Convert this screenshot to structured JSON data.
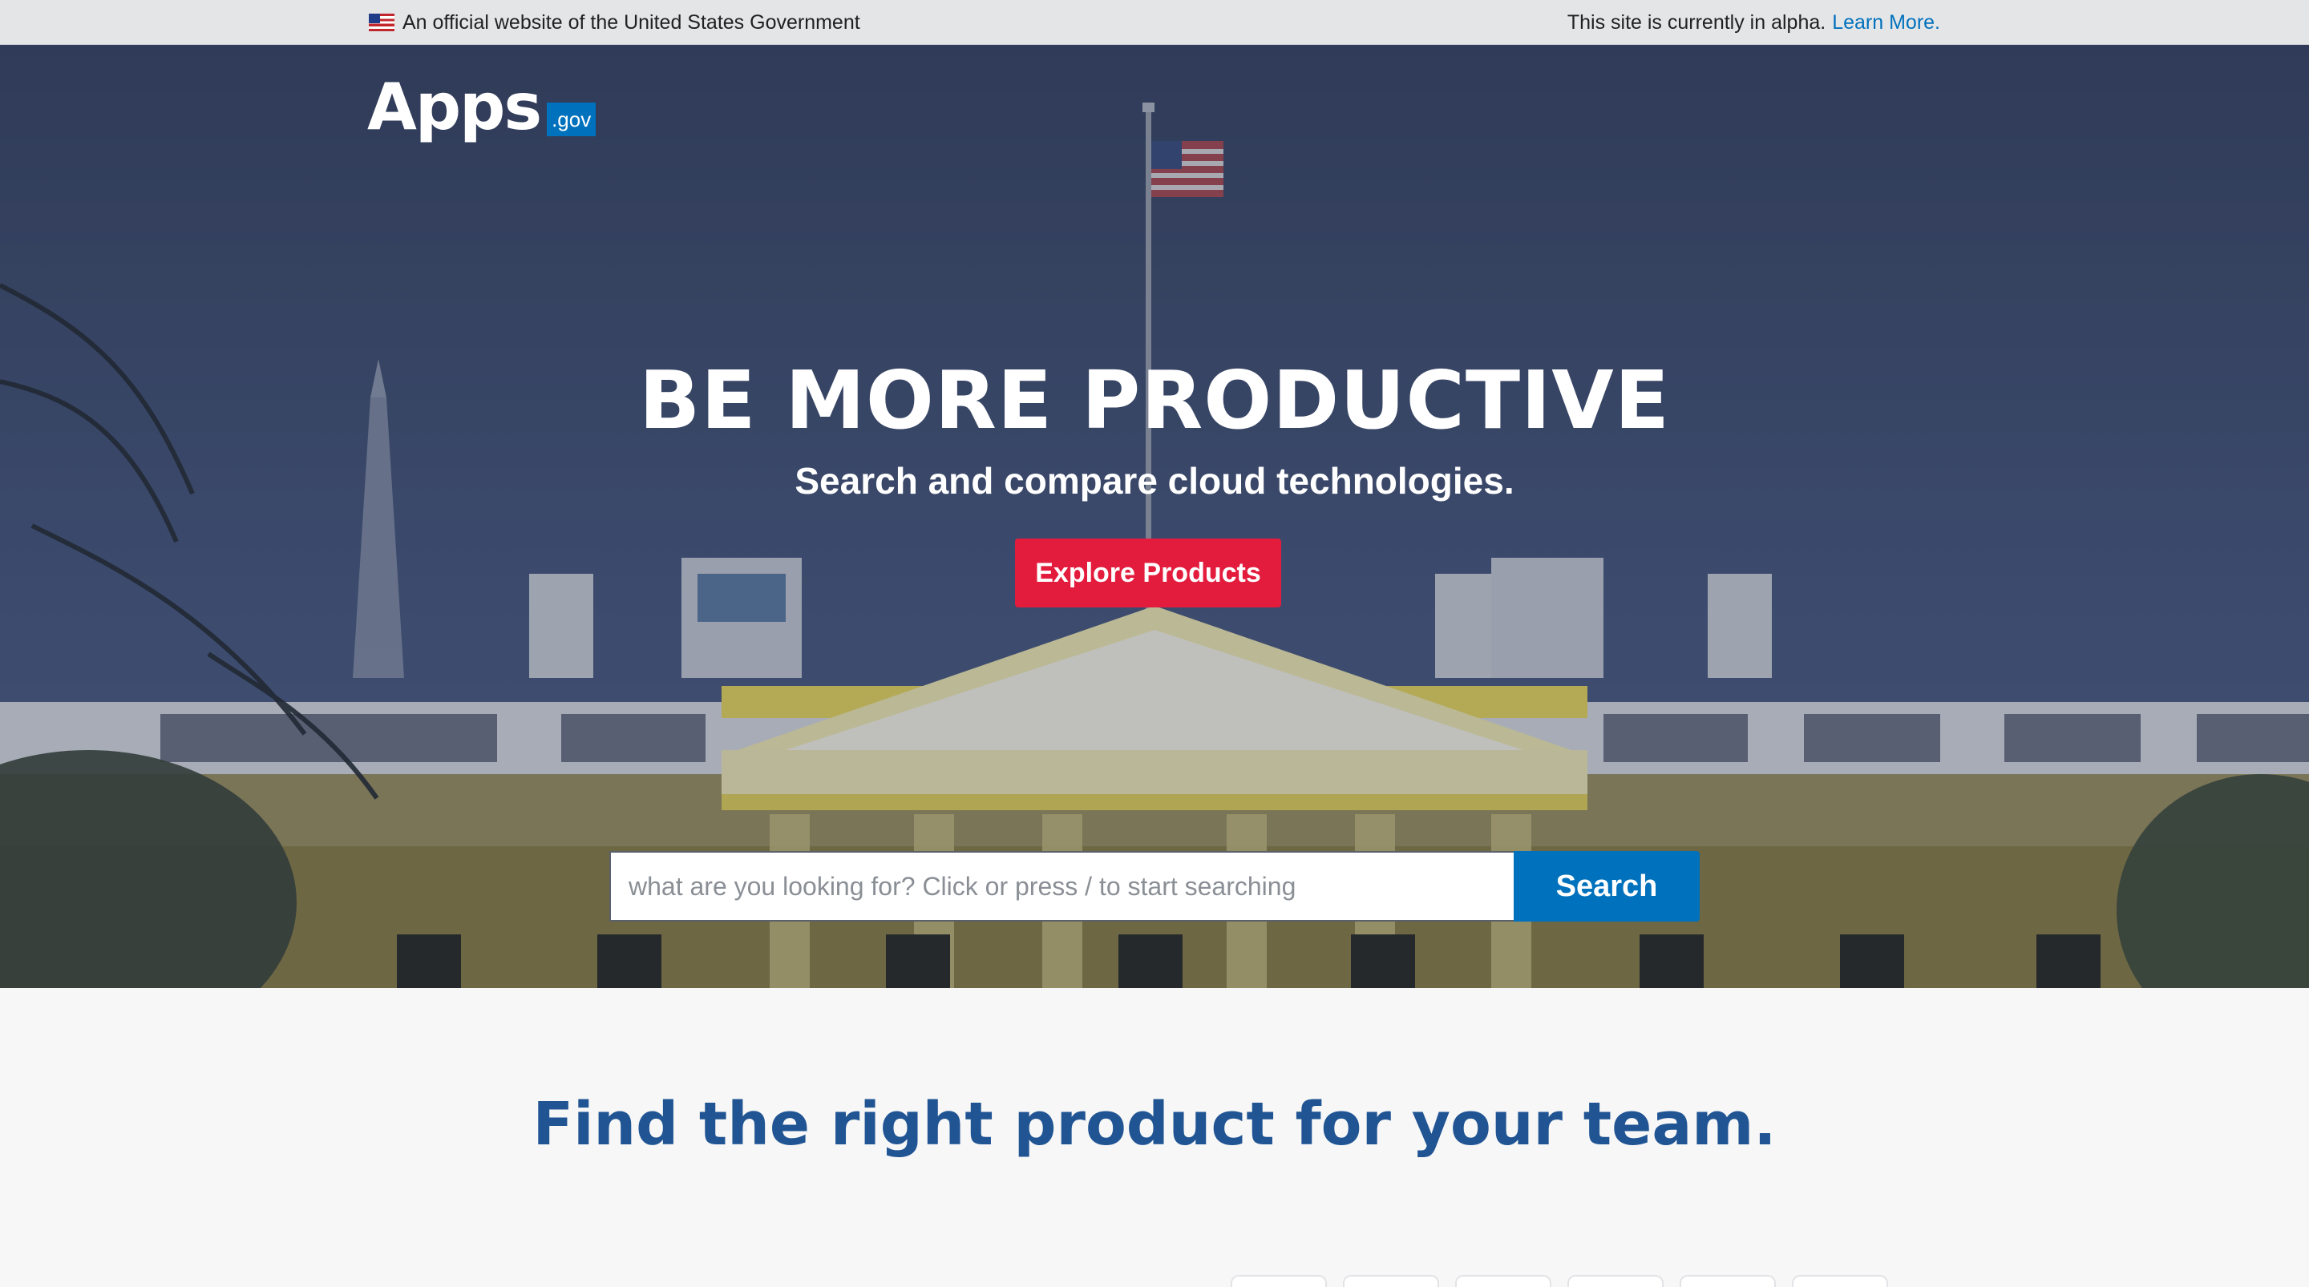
{
  "gov_banner": {
    "official_text": "An official website of the United States Government",
    "alpha_text": "This site is currently in alpha.",
    "learn_more": "Learn More."
  },
  "logo": {
    "word": "Apps",
    "badge": ".gov"
  },
  "hero": {
    "headline": "BE MORE PRODUCTIVE",
    "subheadline": "Search and compare cloud technologies.",
    "explore_button": "Explore Products"
  },
  "search": {
    "placeholder": "what are you looking for? Click or press / to start searching",
    "value": "",
    "button": "Search"
  },
  "section": {
    "title": "Find the right product for your team."
  },
  "icons": {
    "flag": "us-flag-icon"
  },
  "colors": {
    "primary_blue": "#0071bc",
    "accent_red": "#e31c3d",
    "heading_blue": "#205493",
    "banner_gray": "#e4e5e7"
  }
}
